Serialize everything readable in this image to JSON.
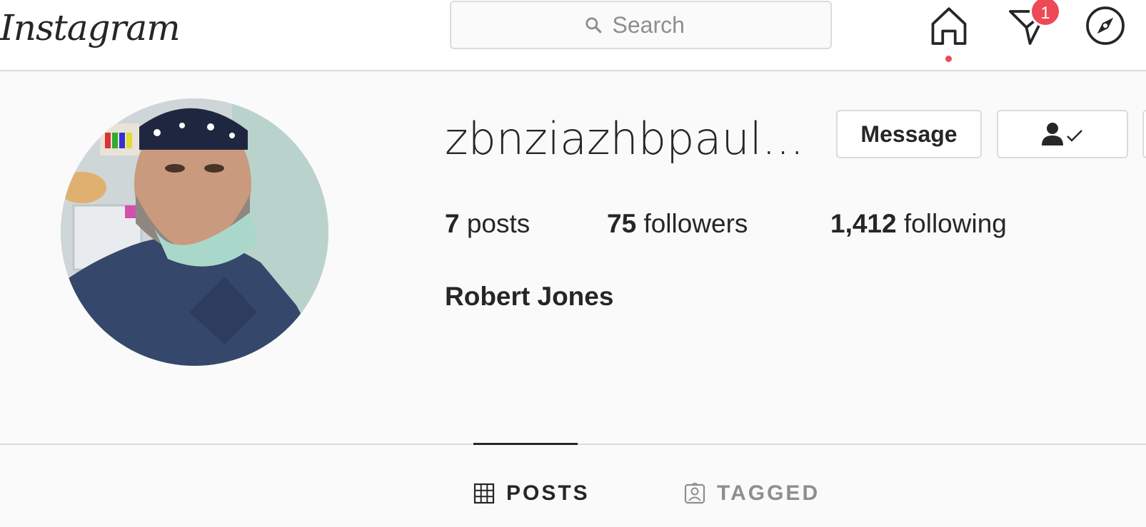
{
  "header": {
    "logo_text": "Instagram",
    "search": {
      "placeholder": "Search",
      "icon": "search-icon"
    },
    "nav": [
      {
        "name": "home",
        "icon": "home-icon",
        "has_dot": true
      },
      {
        "name": "direct",
        "icon": "paper-plane-icon",
        "badge": "1"
      },
      {
        "name": "explore",
        "icon": "compass-icon"
      }
    ]
  },
  "profile": {
    "username": "zbnziazhbpaul...",
    "message_button": "Message",
    "follow_button_icon": "person-check-icon",
    "stats": {
      "posts_count": "7",
      "posts_label": "posts",
      "followers_count": "75",
      "followers_label": "followers",
      "following_count": "1,412",
      "following_label": "following"
    },
    "full_name": "Robert Jones"
  },
  "tabs": [
    {
      "label": "POSTS",
      "icon": "grid-icon",
      "active": true
    },
    {
      "label": "TAGGED",
      "icon": "tagged-icon",
      "active": false
    }
  ],
  "colors": {
    "notification_red": "#ed4956",
    "border": "#dbdbdb",
    "text": "#262626",
    "muted": "#8e8e8e"
  }
}
